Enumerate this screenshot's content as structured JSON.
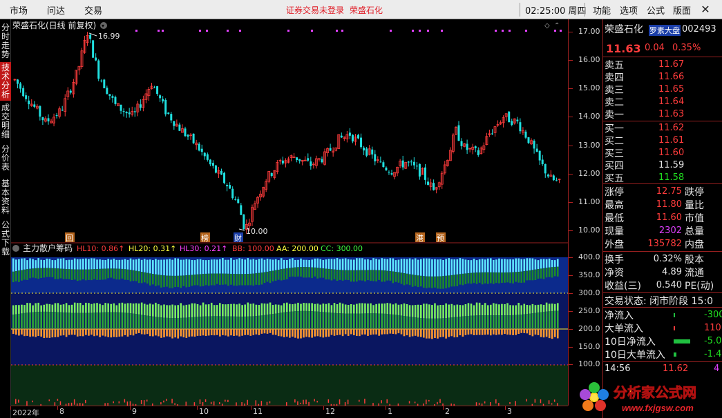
{
  "menu": {
    "items": [
      "市场",
      "问达",
      "交易"
    ],
    "warning": "证券交易未登录",
    "stock_name_top": "荣盛石化",
    "clock": "02:25:00 周四",
    "right_items": [
      "功能",
      "选项",
      "公式",
      "版面"
    ],
    "close_label": "✕"
  },
  "left_tabs": [
    {
      "label": "分时走势",
      "active": false
    },
    {
      "label": "技术分析",
      "active": true
    },
    {
      "label": "成交明细",
      "active": false
    },
    {
      "label": "分价表",
      "active": false
    },
    {
      "label": "基本资料",
      "active": false
    },
    {
      "label": "公式下载",
      "active": false
    }
  ],
  "kline": {
    "title": "荣盛石化(日线 前复权)",
    "high_label": "16.99",
    "low_label": "10.00",
    "markers": [
      "回",
      "榜",
      "财",
      "港",
      "预"
    ],
    "y_ticks": [
      "17.00",
      "16.00",
      "15.00",
      "14.00",
      "13.00",
      "12.00",
      "11.00",
      "10.00"
    ]
  },
  "indicator": {
    "name": "主力散户筹码",
    "params": [
      {
        "text": "HL10: 0.86↑",
        "color": "#ff3c3c"
      },
      {
        "text": "HL20: 0.31↑",
        "color": "#ffff40"
      },
      {
        "text": "HL30: 0.21↑",
        "color": "#ff40ff"
      },
      {
        "text": "BB: 100.00",
        "color": "#ff3c3c"
      },
      {
        "text": "AA: 200.00",
        "color": "#ffff40"
      },
      {
        "text": "CC: 300.00",
        "color": "#40ff40"
      }
    ],
    "y_ticks": [
      "400.0",
      "350.0",
      "300.0",
      "250.0",
      "200.0",
      "150.0",
      "100.0"
    ]
  },
  "x_axis": [
    "2022年",
    "8",
    "9",
    "10",
    "11",
    "12",
    "1",
    "2",
    "3"
  ],
  "quote": {
    "name": "荣盛石化",
    "tag": "罗素大盘",
    "code": "002493",
    "price": "11.63",
    "change": "0.04",
    "pct": "0.35%",
    "asks": [
      {
        "label": "卖五",
        "price": "11.67"
      },
      {
        "label": "卖四",
        "price": "11.66"
      },
      {
        "label": "卖三",
        "price": "11.65"
      },
      {
        "label": "卖二",
        "price": "11.64"
      },
      {
        "label": "卖一",
        "price": "11.63"
      }
    ],
    "bids": [
      {
        "label": "买一",
        "price": "11.62",
        "color": "red"
      },
      {
        "label": "买二",
        "price": "11.61",
        "color": "red"
      },
      {
        "label": "买三",
        "price": "11.60",
        "color": "red"
      },
      {
        "label": "买四",
        "price": "11.59",
        "color": "white"
      },
      {
        "label": "买五",
        "price": "11.58",
        "color": "green"
      }
    ],
    "stats": [
      {
        "label": "涨停",
        "value": "12.75",
        "color": "red",
        "label2": "跌停"
      },
      {
        "label": "最高",
        "value": "11.80",
        "color": "red",
        "label2": "量比"
      },
      {
        "label": "最低",
        "value": "11.60",
        "color": "red",
        "label2": "市值"
      },
      {
        "label": "现量",
        "value": "2302",
        "color": "purple",
        "label2": "总量"
      },
      {
        "label": "外盘",
        "value": "135782",
        "color": "red",
        "label2": "内盘"
      }
    ],
    "stats2": [
      {
        "label": "换手",
        "value": "0.32%",
        "label2": "股本"
      },
      {
        "label": "净资",
        "value": "4.89",
        "label2": "流通"
      },
      {
        "label": "收益(三)",
        "value": "0.540",
        "label2": "PE(动)"
      }
    ],
    "status": "交易状态: 闭市阶段 15:0",
    "flows": [
      {
        "label": "净流入",
        "value": "-300",
        "color": "green"
      },
      {
        "label": "大单流入",
        "value": "110",
        "color": "red"
      },
      {
        "label": "10日净流入",
        "value": "-5.0",
        "color": "green"
      },
      {
        "label": "10日大单流入",
        "value": "-1.4",
        "color": "green"
      }
    ],
    "tick": {
      "time": "14:56",
      "price": "11.62",
      "vol": "4"
    }
  },
  "logo": {
    "text": "分析家公式网",
    "url_text": "www.fxjgsw.com"
  },
  "colors": {
    "up": "#ff3c3c",
    "down": "#20e0e0",
    "grid": "#9a2020"
  }
}
